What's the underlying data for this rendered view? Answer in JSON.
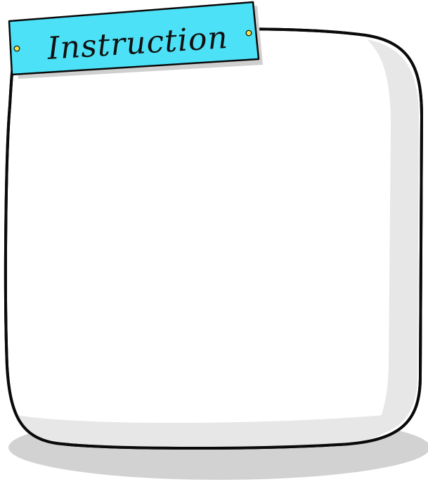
{
  "instruction_card": {
    "label": "Instruction",
    "colors": {
      "sign_fill": "#4de1f7",
      "sign_outline": "#0a0a0a",
      "rivet": "#f3e24a",
      "panel_fill": "#ffffff",
      "panel_shade": "#e7e7e7",
      "panel_outline": "#0a0a0a",
      "ground_shadow": "#d2d2d2"
    },
    "icons": [
      "rivet-left-icon",
      "rivet-right-icon"
    ]
  }
}
